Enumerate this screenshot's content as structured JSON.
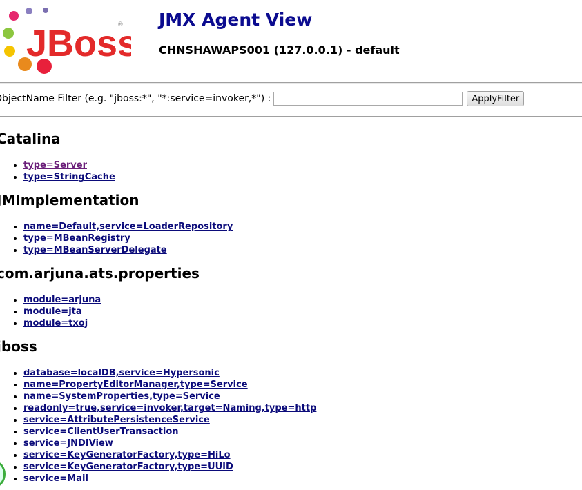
{
  "header": {
    "logo_text": "JBoss",
    "title": "JMX Agent View",
    "subtitle": "CHNSHAWAPS001 (127.0.0.1) - default"
  },
  "filter": {
    "label": "ObjectName Filter (e.g. \"jboss:*\", \"*:service=invoker,*\") :",
    "value": "",
    "button_label": "ApplyFilter"
  },
  "domains": [
    {
      "name": "Catalina",
      "mbeans": [
        "type=Server",
        "type=StringCache"
      ]
    },
    {
      "name": "JMImplementation",
      "mbeans": [
        "name=Default,service=LoaderRepository",
        "type=MBeanRegistry",
        "type=MBeanServerDelegate"
      ]
    },
    {
      "name": "com.arjuna.ats.properties",
      "mbeans": [
        "module=arjuna",
        "module=jta",
        "module=txoj"
      ]
    },
    {
      "name": "jboss",
      "mbeans": [
        "database=localDB,service=Hypersonic",
        "name=PropertyEditorManager,type=Service",
        "name=SystemProperties,type=Service",
        "readonly=true,service=invoker,target=Naming,type=http",
        "service=AttributePersistenceService",
        "service=ClientUserTransaction",
        "service=JNDIView",
        "service=KeyGeneratorFactory,type=HiLo",
        "service=KeyGeneratorFactory,type=UUID",
        "service=Mail"
      ]
    }
  ],
  "colors": {
    "title": "#0b0b8f",
    "link": "#0b0b7a",
    "visited_link": "#6b1f7a"
  }
}
